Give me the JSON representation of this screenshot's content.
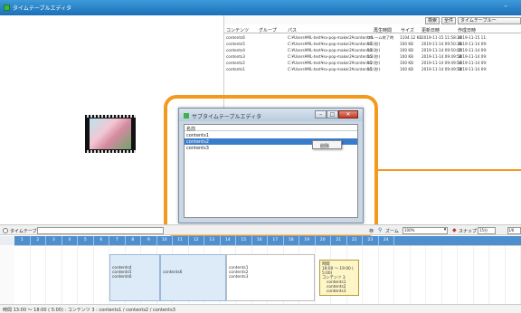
{
  "window": {
    "title": "タイムテーブルエディタ",
    "minimize": "–"
  },
  "toolbar": {
    "search": "検索",
    "all": "全件",
    "timetable_list": "タイムテーブル一"
  },
  "list": {
    "columns": [
      "コンテンツ",
      "グループ",
      "パス",
      "再生時間",
      "サイズ",
      "更新日時",
      "作成日時"
    ],
    "rows": [
      [
        "contents6",
        "",
        "C:¥Users¥ML-test¥sv-pop-maker2¥contents6",
        "フレーム終了時",
        "1104.12 KB",
        "2019-11-15 11:58:34",
        "2019-11-15 11:"
      ],
      [
        "contents5",
        "",
        "C:¥Users¥ML-test¥sv-pop-maker2¥contents5",
        "15 (秒)",
        "100 KB",
        "2019-11-14 09:50:36",
        "2019-11-14 09:"
      ],
      [
        "contents4",
        "",
        "C:¥Users¥ML-test¥sv-pop-maker2¥contents4",
        "15 (秒)",
        "100 KB",
        "2019-11-14 09:50:02",
        "2019-11-14 09:"
      ],
      [
        "contents3",
        "",
        "C:¥Users¥ML-test¥sv-pop-maker2¥contents3",
        "15 (秒)",
        "100 KB",
        "2019-11-14 09:49:58",
        "2019-11-14 09:"
      ],
      [
        "contents2",
        "",
        "C:¥Users¥ML-test¥sv-pop-maker2¥contents2",
        "15 (秒)",
        "100 KB",
        "2019-11-14 09:49:54",
        "2019-11-14 09:"
      ],
      [
        "contents1",
        "",
        "C:¥Users¥ML-test¥sv-pop-maker2¥contents1",
        "15 (秒)",
        "100 KB",
        "2019-11-14 09:49:50",
        "2019-11-14 09:"
      ]
    ]
  },
  "dialog": {
    "title": "サブタイムテーブルエディタ",
    "minimize": "–",
    "maximize": "□",
    "close": "✕",
    "column": "名前",
    "items": [
      "contents1",
      "contents2",
      "contents3"
    ],
    "selected_index": 1,
    "context_menu": "削除"
  },
  "timeline_controls": {
    "timetable_name_label": "タイムテーブル名",
    "save_label": "存",
    "zoom_label": "ズーム",
    "zoom_value": "100%",
    "snap_label": "スナップ",
    "snap_value": "15分",
    "v_button": "1/6"
  },
  "ruler": [
    "1",
    "2",
    "3",
    "4",
    "5",
    "6",
    "7",
    "8",
    "9",
    "10",
    "11",
    "12",
    "13",
    "14",
    "15",
    "16",
    "17",
    "18",
    "19",
    "20",
    "21",
    "22",
    "23",
    "24"
  ],
  "blocks": [
    {
      "lines": [
        "contents4",
        "contents5",
        "contents6"
      ],
      "style": "selected"
    },
    {
      "lines": [
        "contents6"
      ],
      "style": "selected"
    },
    {
      "lines": [
        "contents1",
        "contents2",
        "contents3"
      ],
      "style": "plain"
    }
  ],
  "tooltip": {
    "heading": "時間",
    "time": "18:00 ～ 19:00 ( 5:00)",
    "contents_label": "コンテンツ",
    "contents_count": "3",
    "items": [
      "contents1",
      "contents2",
      "contents3"
    ]
  },
  "status": "時間 13:00 ～ 18:00 ( 5:00) : コンテンツ 3 : contents1 / contents2 / contents3",
  "colors": {
    "accent": "#f39a1e",
    "titlebar": "#1c6fb8",
    "ruler": "#4e8fcf",
    "selection": "#3a7ccc"
  }
}
